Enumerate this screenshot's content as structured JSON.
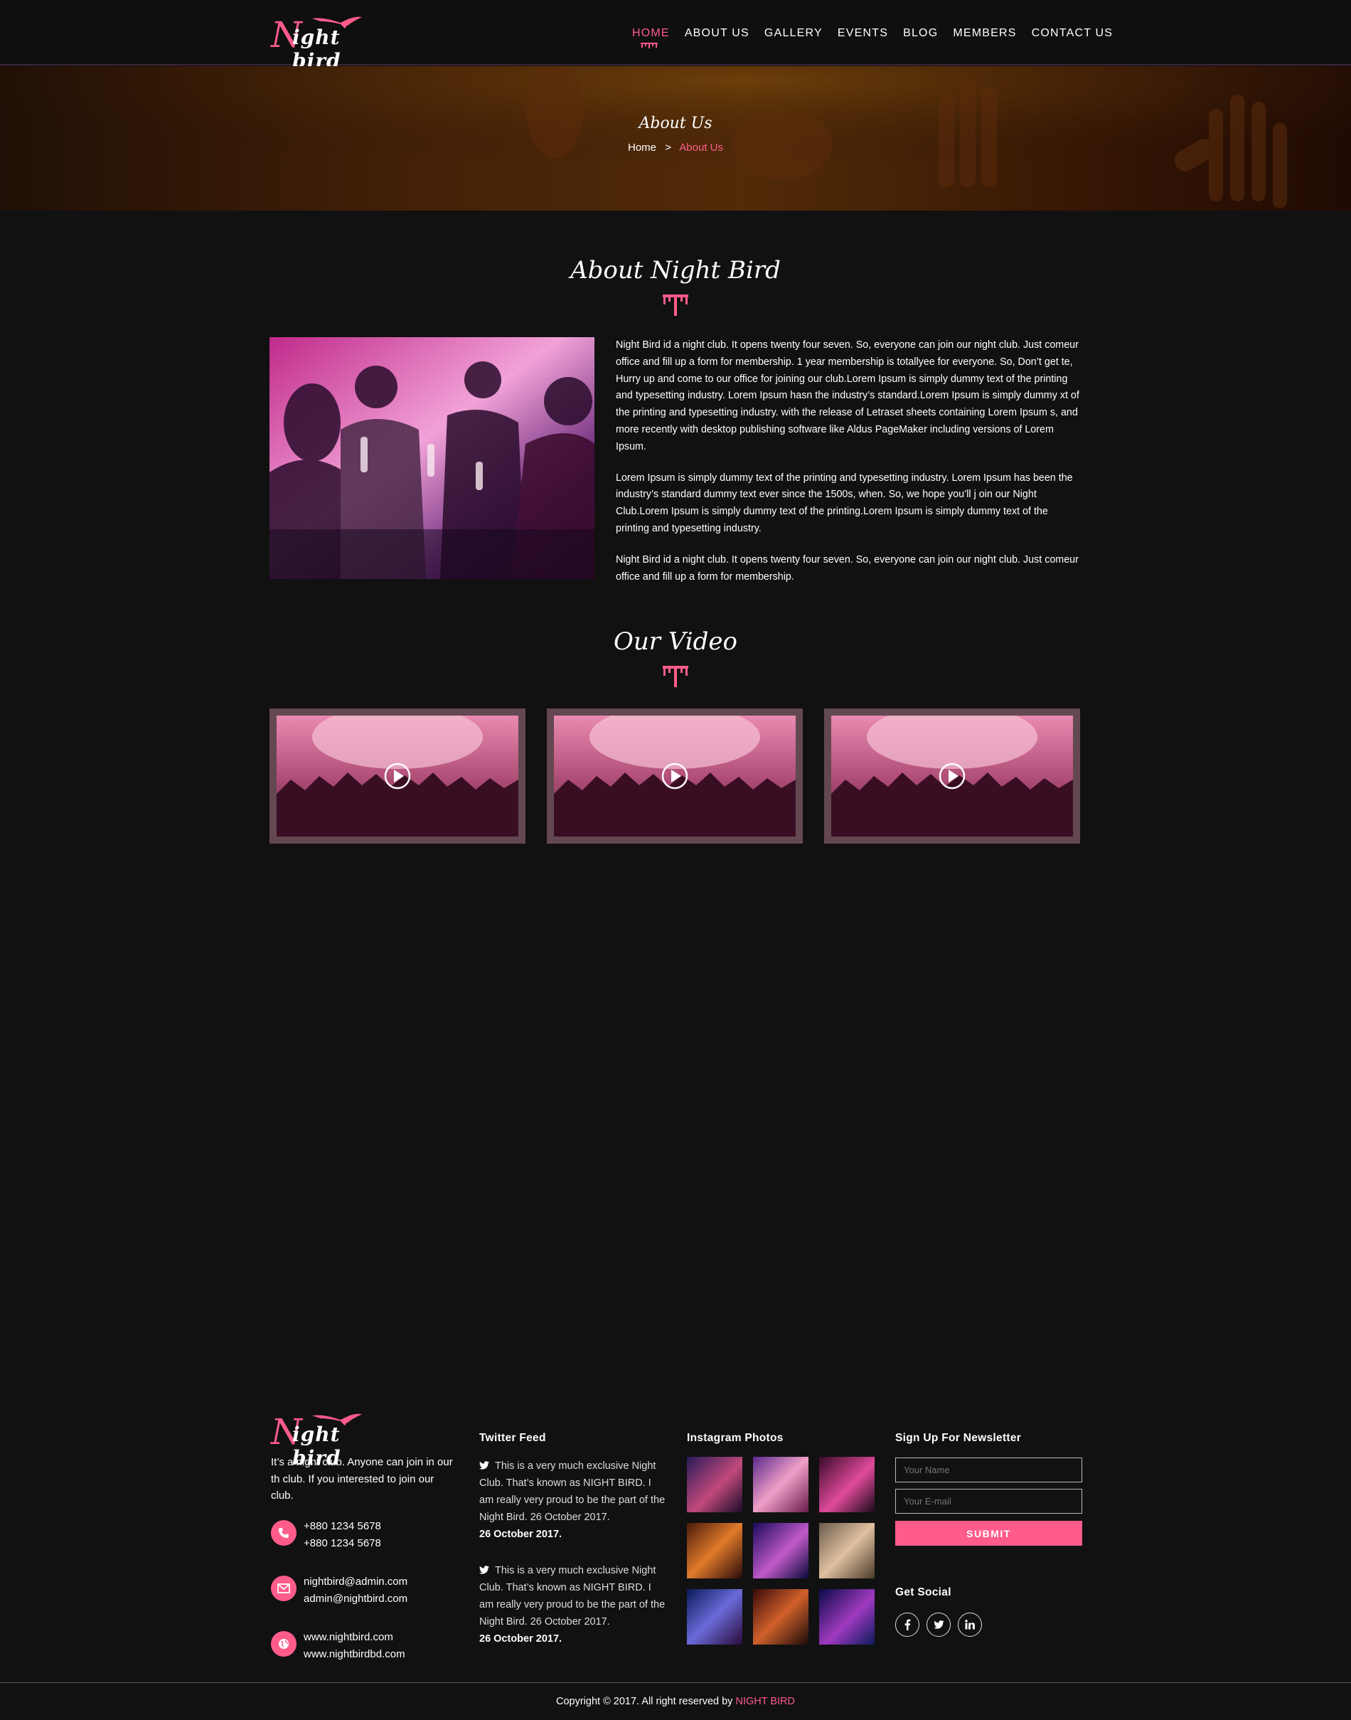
{
  "brand": {
    "logo_initial": "N",
    "logo_rest": "ight bird",
    "accent_color": "#ff5c8a"
  },
  "nav": {
    "items": [
      {
        "label": "HOME",
        "active": true
      },
      {
        "label": "ABOUT US"
      },
      {
        "label": "GALLERY"
      },
      {
        "label": "EVENTS"
      },
      {
        "label": "BLOG"
      },
      {
        "label": "MEMBERS"
      },
      {
        "label": "CONTACT US"
      }
    ]
  },
  "banner": {
    "title": "About Us",
    "breadcrumb_home": "Home",
    "breadcrumb_separator": ">",
    "breadcrumb_current": "About Us"
  },
  "about": {
    "title": "About Night Bird",
    "paragraphs": [
      "Night Bird id a night club. It opens twenty four seven. So, everyone can join our night club. Just comeur office and fill up a form for membership. 1 year membership is totallyee for everyone. So, Don’t get te, Hurry up and come to our office for joining our club.Lorem Ipsum is simply dummy text of the printing and typesetting industry. Lorem Ipsum hasn the industry’s standard.Lorem Ipsum is simply dummy xt of the printing and typesetting industry. with the release of Letraset sheets containing Lorem Ipsum s, and more recently with desktop publishing software like Aldus PageMaker including versions of Lorem Ipsum.",
      "Lorem Ipsum is simply dummy text of the printing and typesetting industry. Lorem Ipsum has been the industry’s standard dummy text ever since the 1500s, when. So, we hope you’ll j oin our Night Club.Lorem Ipsum is simply dummy text of the printing.Lorem Ipsum is simply dummy text of the printing and typesetting industry.",
      "Night Bird id a night club. It opens twenty four seven. So, everyone can join our night club. Just comeur office and fill up a form for membership."
    ]
  },
  "videos": {
    "title": "Our Video",
    "count": 3
  },
  "footer": {
    "about_text": "It’s a night club. Anyone can join in our th club. If you interested to join our club.",
    "phones": [
      "+880 1234 5678",
      "+880 1234 5678"
    ],
    "emails": [
      "nightbird@admin.com",
      "admin@nightbird.com"
    ],
    "websites": [
      "www.nightbird.com",
      "www.nightbirdbd.com"
    ],
    "twitter": {
      "title": "Twitter Feed",
      "tweets": [
        {
          "text": "This is a very much exclusive Night Club. That’s known as NIGHT BIRD. I am really very proud to be the part of the Night Bird. 26 October 2017.",
          "date": "26 October 2017."
        },
        {
          "text": "This is a very much exclusive Night Club. That’s known as NIGHT BIRD. I am really very proud to be the part of the Night Bird. 26 October 2017.",
          "date": "26 October 2017."
        }
      ]
    },
    "instagram": {
      "title": "Instagram Photos",
      "count": 9
    },
    "newsletter": {
      "title": "Sign Up For Newsletter",
      "name_placeholder": "Your Name",
      "email_placeholder": "Your E-mail",
      "submit_label": "SUBMIT"
    },
    "social": {
      "title": "Get Social",
      "icons": [
        "facebook-icon",
        "twitter-icon",
        "linkedin-icon"
      ]
    },
    "copyright_prefix": "Copyright © 2017. All right reserved by",
    "copyright_brand": "NIGHT BIRD"
  }
}
